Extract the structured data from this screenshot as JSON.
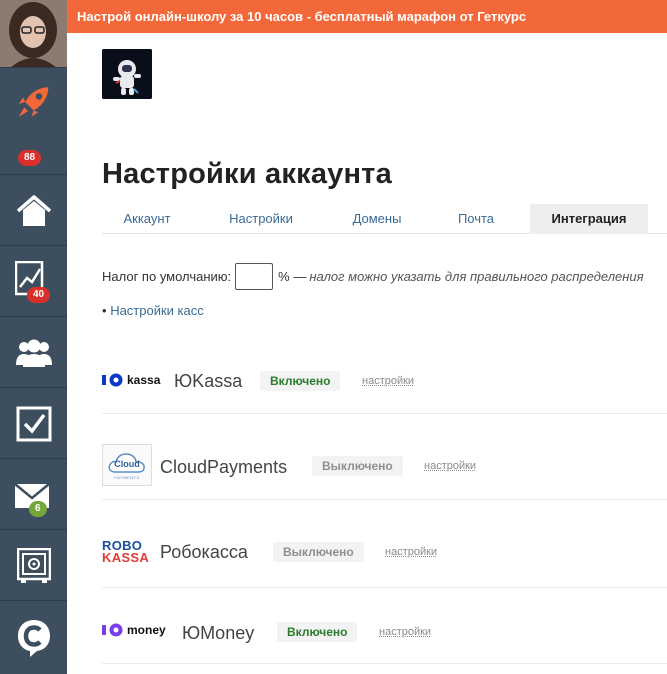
{
  "banner": {
    "text": "Настрой онлайн-школу за 10 часов - бесплатный марафон от Геткурс"
  },
  "sidebar": {
    "items": [
      {
        "icon": "rocket-icon",
        "badge": "88",
        "badge_color": "#d9302c"
      },
      {
        "icon": "home-icon"
      },
      {
        "icon": "chart-icon",
        "badge": "40",
        "badge_color": "#d9302c"
      },
      {
        "icon": "users-icon"
      },
      {
        "icon": "checkbox-icon"
      },
      {
        "icon": "mail-icon",
        "badge": "6",
        "badge_color": "#75a63a"
      },
      {
        "icon": "safe-icon"
      },
      {
        "icon": "getcourse-logo-icon"
      }
    ]
  },
  "page": {
    "title": "Настройки аккаунта"
  },
  "tabs": [
    {
      "label": "Аккаунт"
    },
    {
      "label": "Настройки"
    },
    {
      "label": "Домены"
    },
    {
      "label": "Почта"
    },
    {
      "label": "Интеграция",
      "active": true
    }
  ],
  "tax": {
    "label": "Налог по умолчанию:",
    "value": "",
    "suffix": "% —",
    "note": "налог можно указать для правильного распределения"
  },
  "kassa_settings": {
    "bullet": "•",
    "label": "Настройки касс"
  },
  "providers": [
    {
      "logo_text": "kassa",
      "name": "ЮKassa",
      "status": "Включено",
      "settings": "настройки"
    },
    {
      "logo_text": "Cloud",
      "logo_sub": "PAYMENTS",
      "name": "CloudPayments",
      "status": "Выключено",
      "settings": "настройки"
    },
    {
      "logo_top": "ROBO",
      "logo_bottom": "KASSA",
      "name": "Робокасса",
      "status": "Выключено",
      "settings": "настройки"
    },
    {
      "logo_text": "money",
      "name": "ЮMoney",
      "status": "Включено",
      "settings": "настройки"
    }
  ],
  "colors": {
    "accent": "#f2683a",
    "sidebar": "#3d4e5e",
    "link": "#3a6b94",
    "enabled": "#2a7d2a",
    "disabled": "#8f8f8f"
  }
}
